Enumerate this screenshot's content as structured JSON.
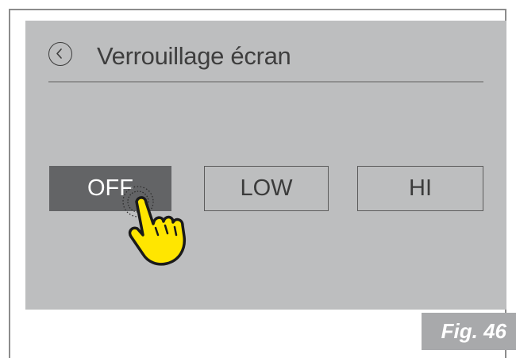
{
  "header": {
    "back_icon": "chevron-left-circle-icon",
    "title": "Verrouillage écran"
  },
  "options": [
    {
      "label": "OFF",
      "selected": true
    },
    {
      "label": "LOW",
      "selected": false
    },
    {
      "label": "HI",
      "selected": false
    }
  ],
  "pointer": {
    "icon": "tapping-hand-icon",
    "color": "#ffe600"
  },
  "figure_label": "Fig. 46",
  "colors": {
    "screen_bg": "#bdbebf",
    "selected_bg": "#636466",
    "figure_tag_bg": "#a8a9ab"
  }
}
